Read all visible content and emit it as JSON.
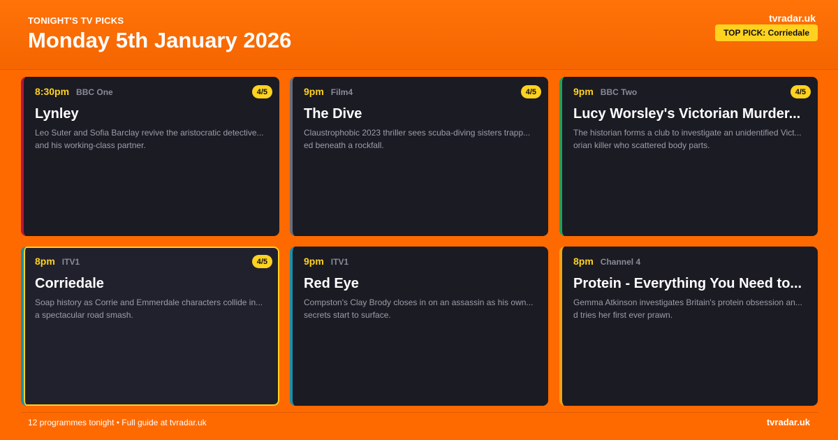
{
  "header": {
    "eyebrow": "TONIGHT'S TV PICKS",
    "date": "Monday 5th January 2026",
    "brand": "tvradar.uk",
    "top_pick": "TOP PICK: Corriedale"
  },
  "colors": {
    "background": "#ff6a00",
    "card": "#1b1b24",
    "accent": "#ffd21f",
    "bbc_one": "#b3163a",
    "film4": "#6c6c78",
    "bbc_two": "#23a05a",
    "itv1": "#1c8fa8",
    "channel4": "#f2a215"
  },
  "programmes": [
    {
      "time": "8:30pm",
      "channel": "BBC One",
      "rating": "4/5",
      "title": "Lynley",
      "description": "Leo Suter and Sofia Barclay revive the aristocratic detective... and his working-class partner."
    },
    {
      "time": "9pm",
      "channel": "Film4",
      "rating": "4/5",
      "title": "The Dive",
      "description": "Claustrophobic 2023 thriller sees scuba-diving sisters trapp... ed beneath a rockfall."
    },
    {
      "time": "9pm",
      "channel": "BBC Two",
      "rating": "4/5",
      "title": "Lucy Worsley's Victorian Murder...",
      "description": "The historian forms a club to investigate an unidentified Vict... orian killer who scattered body parts."
    },
    {
      "time": "8pm",
      "channel": "ITV1",
      "rating": "4/5",
      "title": "Corriedale",
      "description": "Soap history as Corrie and Emmerdale characters collide in... a spectacular road smash."
    },
    {
      "time": "9pm",
      "channel": "ITV1",
      "title": "Red Eye",
      "description": "Compston's Clay Brody closes in on an assassin as his own... secrets start to surface."
    },
    {
      "time": "8pm",
      "channel": "Channel 4",
      "title": "Protein - Everything You Need to...",
      "description": "Gemma Atkinson investigates Britain's protein obsession an... d tries her first ever prawn."
    }
  ],
  "footer": {
    "left": "12 programmes tonight • Full guide at tvradar.uk",
    "brand": "tvradar.uk"
  }
}
